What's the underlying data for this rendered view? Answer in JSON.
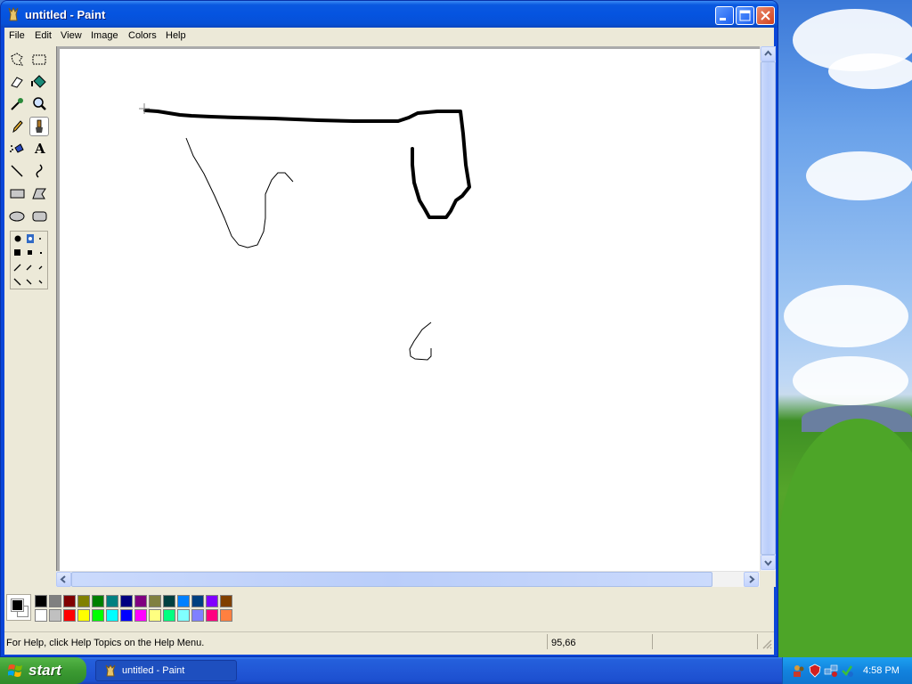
{
  "window": {
    "title": "untitled - Paint",
    "buttons": [
      "minimize",
      "maximize",
      "close"
    ]
  },
  "menu": [
    "File",
    "Edit",
    "View",
    "Image",
    "Colors",
    "Help"
  ],
  "toolbox": {
    "tools": [
      {
        "name": "free-form-select-icon",
        "active": false
      },
      {
        "name": "rectangle-select-icon",
        "active": false
      },
      {
        "name": "eraser-icon",
        "active": false
      },
      {
        "name": "fill-bucket-icon",
        "active": false
      },
      {
        "name": "color-picker-icon",
        "active": false
      },
      {
        "name": "magnifier-icon",
        "active": false
      },
      {
        "name": "pencil-icon",
        "active": false
      },
      {
        "name": "brush-icon",
        "active": true
      },
      {
        "name": "airbrush-icon",
        "active": false
      },
      {
        "name": "text-icon",
        "active": false
      },
      {
        "name": "line-icon",
        "active": false
      },
      {
        "name": "curve-icon",
        "active": false
      },
      {
        "name": "rectangle-icon",
        "active": false
      },
      {
        "name": "polygon-icon",
        "active": false
      },
      {
        "name": "ellipse-icon",
        "active": false
      },
      {
        "name": "rounded-rectangle-icon",
        "active": false
      }
    ],
    "text_tool_glyph": "A"
  },
  "palette": {
    "foreground": "#000000",
    "background": "#ffffff",
    "row1": [
      "#000000",
      "#808080",
      "#800000",
      "#808000",
      "#008000",
      "#008080",
      "#000080",
      "#800080",
      "#808040",
      "#004040",
      "#0080ff",
      "#004080",
      "#8000ff",
      "#804000"
    ],
    "row2": [
      "#ffffff",
      "#c0c0c0",
      "#ff0000",
      "#ffff00",
      "#00ff00",
      "#00ffff",
      "#0000ff",
      "#ff00ff",
      "#ffff80",
      "#00ff80",
      "#80ffff",
      "#8080ff",
      "#ff0080",
      "#ff8040"
    ]
  },
  "status": {
    "help": "For Help, click Help Topics on the Help Menu.",
    "coords": "95,66"
  },
  "taskbar": {
    "start": "start",
    "task": "untitled - Paint",
    "clock": "4:58 PM"
  }
}
